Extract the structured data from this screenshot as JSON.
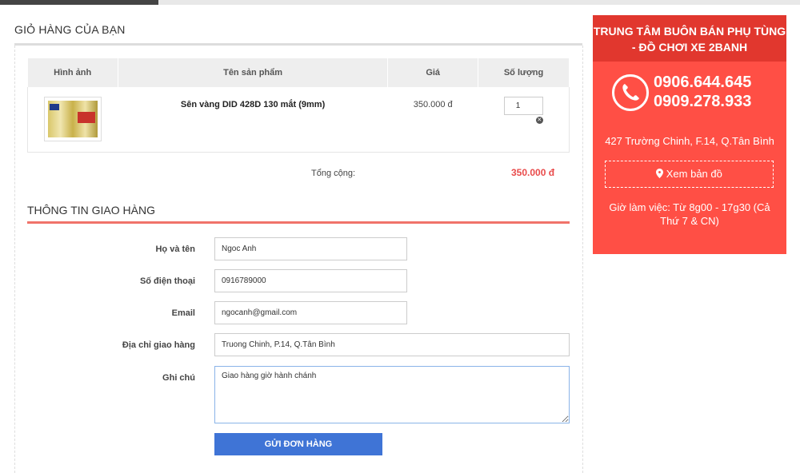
{
  "cart": {
    "title": "GIỎ HÀNG CỦA BẠN",
    "columns": [
      "Hình ảnh",
      "Tên sản phẩm",
      "Giá",
      "Số lượng"
    ],
    "items": [
      {
        "name": "Sên vàng DID 428D 130 mắt (9mm)",
        "price": "350.000 đ",
        "quantity": "1",
        "image_icon": "product-chain-image"
      }
    ],
    "total_label": "Tổng cộng:",
    "total_value": "350.000 đ"
  },
  "shipping": {
    "title": "THÔNG TIN GIAO HÀNG",
    "fields": {
      "name_label": "Họ và tên",
      "name_value": "Ngoc Anh",
      "phone_label": "Số điện thoại",
      "phone_value": "0916789000",
      "email_label": "Email",
      "email_value": "ngocanh@gmail.com",
      "address_label": "Địa chỉ giao hàng",
      "address_value": "Truong Chinh, P.14, Q.Tân Bình",
      "note_label": "Ghi chú",
      "note_value": "Giao hàng giờ hành chánh"
    },
    "submit_label": "GỬI ĐƠN HÀNG"
  },
  "sidebar": {
    "title": "TRUNG TÂM BUÔN BÁN PHỤ TÙNG - ĐỒ CHƠI XE 2BANH",
    "phone_1": "0906.644.645",
    "phone_2": "0909.278.933",
    "address": "427 Trường Chinh, F.14, Q.Tân Bình",
    "map_label": "Xem bản đồ",
    "hours": "Giờ làm việc: Từ 8g00 - 17g30 (Cả Thứ 7 & CN)"
  },
  "colors": {
    "accent_red": "#ff4f45",
    "header_red": "#e1372e",
    "total_red": "#e94b4b",
    "button_blue": "#3f74d6"
  }
}
